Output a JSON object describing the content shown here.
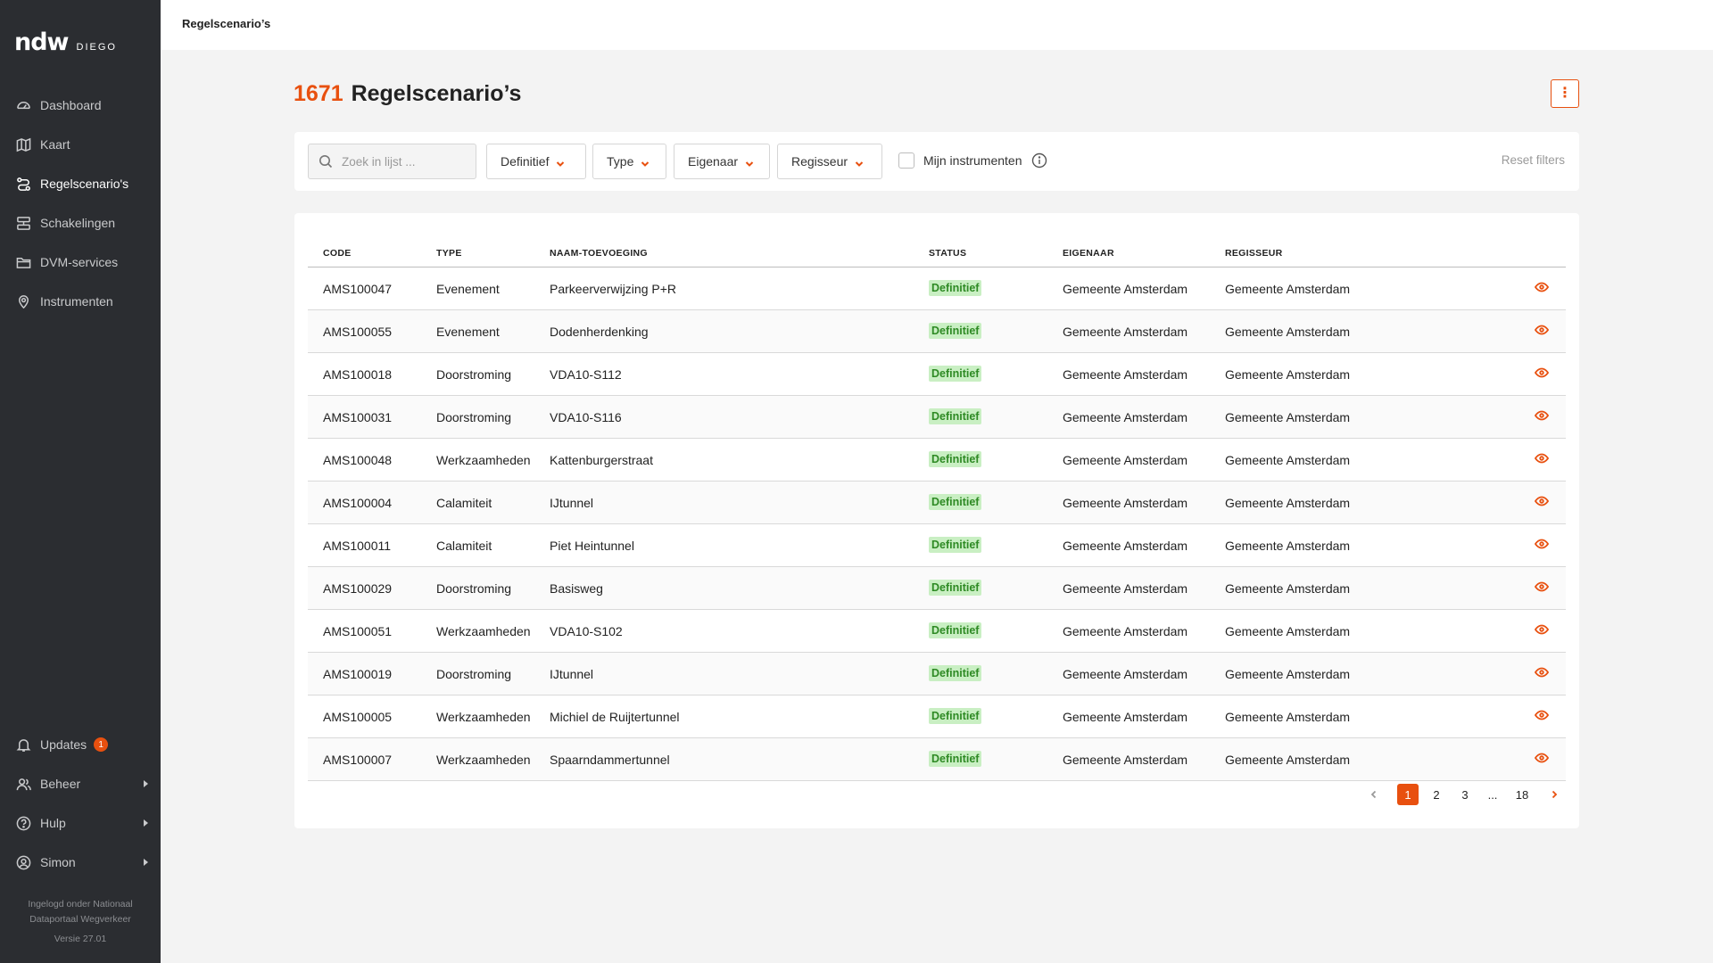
{
  "app": {
    "logo": "ndw",
    "logo_sub": "DIEGO",
    "page_header": "Regelscenario’s"
  },
  "sidebar": {
    "items": [
      {
        "label": "Dashboard",
        "icon": "dashboard-icon"
      },
      {
        "label": "Kaart",
        "icon": "map-icon"
      },
      {
        "label": "Regelscenario's",
        "icon": "route-icon",
        "active": true
      },
      {
        "label": "Schakelingen",
        "icon": "stack-icon"
      },
      {
        "label": "DVM-services",
        "icon": "folder-icon"
      },
      {
        "label": "Instrumenten",
        "icon": "pin-icon"
      }
    ],
    "bottom": {
      "updates_label": "Updates",
      "updates_count": "1",
      "beheer_label": "Beheer",
      "hulp_label": "Hulp",
      "user_label": "Simon"
    },
    "footer_line1": "Ingelogd onder Nationaal",
    "footer_line2": "Dataportaal Wegverkeer",
    "version": "Versie 27.01"
  },
  "main": {
    "count": "1671",
    "title": "Regelscenario’s"
  },
  "filters": {
    "search_placeholder": "Zoek in lijst ...",
    "status_label": "Definitief",
    "type_label": "Type",
    "owner_label": "Eigenaar",
    "director_label": "Regisseur",
    "checkbox_label": "Mijn instrumenten",
    "reset_label": "Reset filters"
  },
  "table": {
    "headers": {
      "code": "CODE",
      "type": "TYPE",
      "name": "NAAM-TOEVOEGING",
      "status": "STATUS",
      "owner": "EIGENAAR",
      "director": "REGISSEUR"
    },
    "rows": [
      {
        "code": "AMS100047",
        "type": "Evenement",
        "name": "Parkeerverwijzing P+R",
        "status": "Definitief",
        "owner": "Gemeente Amsterdam",
        "director": "Gemeente Amsterdam"
      },
      {
        "code": "AMS100055",
        "type": "Evenement",
        "name": "Dodenherdenking",
        "status": "Definitief",
        "owner": "Gemeente Amsterdam",
        "director": "Gemeente Amsterdam"
      },
      {
        "code": "AMS100018",
        "type": "Doorstroming",
        "name": "VDA10-S112",
        "status": "Definitief",
        "owner": "Gemeente Amsterdam",
        "director": "Gemeente Amsterdam"
      },
      {
        "code": "AMS100031",
        "type": "Doorstroming",
        "name": "VDA10-S116",
        "status": "Definitief",
        "owner": "Gemeente Amsterdam",
        "director": "Gemeente Amsterdam"
      },
      {
        "code": "AMS100048",
        "type": "Werkzaamheden",
        "name": "Kattenburgerstraat",
        "status": "Definitief",
        "owner": "Gemeente Amsterdam",
        "director": "Gemeente Amsterdam"
      },
      {
        "code": "AMS100004",
        "type": "Calamiteit",
        "name": "IJtunnel",
        "status": "Definitief",
        "owner": "Gemeente Amsterdam",
        "director": "Gemeente Amsterdam"
      },
      {
        "code": "AMS100011",
        "type": "Calamiteit",
        "name": "Piet Heintunnel",
        "status": "Definitief",
        "owner": "Gemeente Amsterdam",
        "director": "Gemeente Amsterdam"
      },
      {
        "code": "AMS100029",
        "type": "Doorstroming",
        "name": "Basisweg",
        "status": "Definitief",
        "owner": "Gemeente Amsterdam",
        "director": "Gemeente Amsterdam"
      },
      {
        "code": "AMS100051",
        "type": "Werkzaamheden",
        "name": "VDA10-S102",
        "status": "Definitief",
        "owner": "Gemeente Amsterdam",
        "director": "Gemeente Amsterdam"
      },
      {
        "code": "AMS100019",
        "type": "Doorstroming",
        "name": "IJtunnel",
        "status": "Definitief",
        "owner": "Gemeente Amsterdam",
        "director": "Gemeente Amsterdam"
      },
      {
        "code": "AMS100005",
        "type": "Werkzaamheden",
        "name": "Michiel de Ruijtertunnel",
        "status": "Definitief",
        "owner": "Gemeente Amsterdam",
        "director": "Gemeente Amsterdam"
      },
      {
        "code": "AMS100007",
        "type": "Werkzaamheden",
        "name": "Spaarndammertunnel",
        "status": "Definitief",
        "owner": "Gemeente Amsterdam",
        "director": "Gemeente Amsterdam"
      }
    ]
  },
  "pagination": {
    "pages": [
      "1",
      "2",
      "3",
      "...",
      "18"
    ],
    "current": "1"
  },
  "colors": {
    "accent": "#e8500f",
    "sidebar_bg": "#2b2d31",
    "status_bg": "#c9efc3",
    "status_text": "#2e8a24"
  }
}
